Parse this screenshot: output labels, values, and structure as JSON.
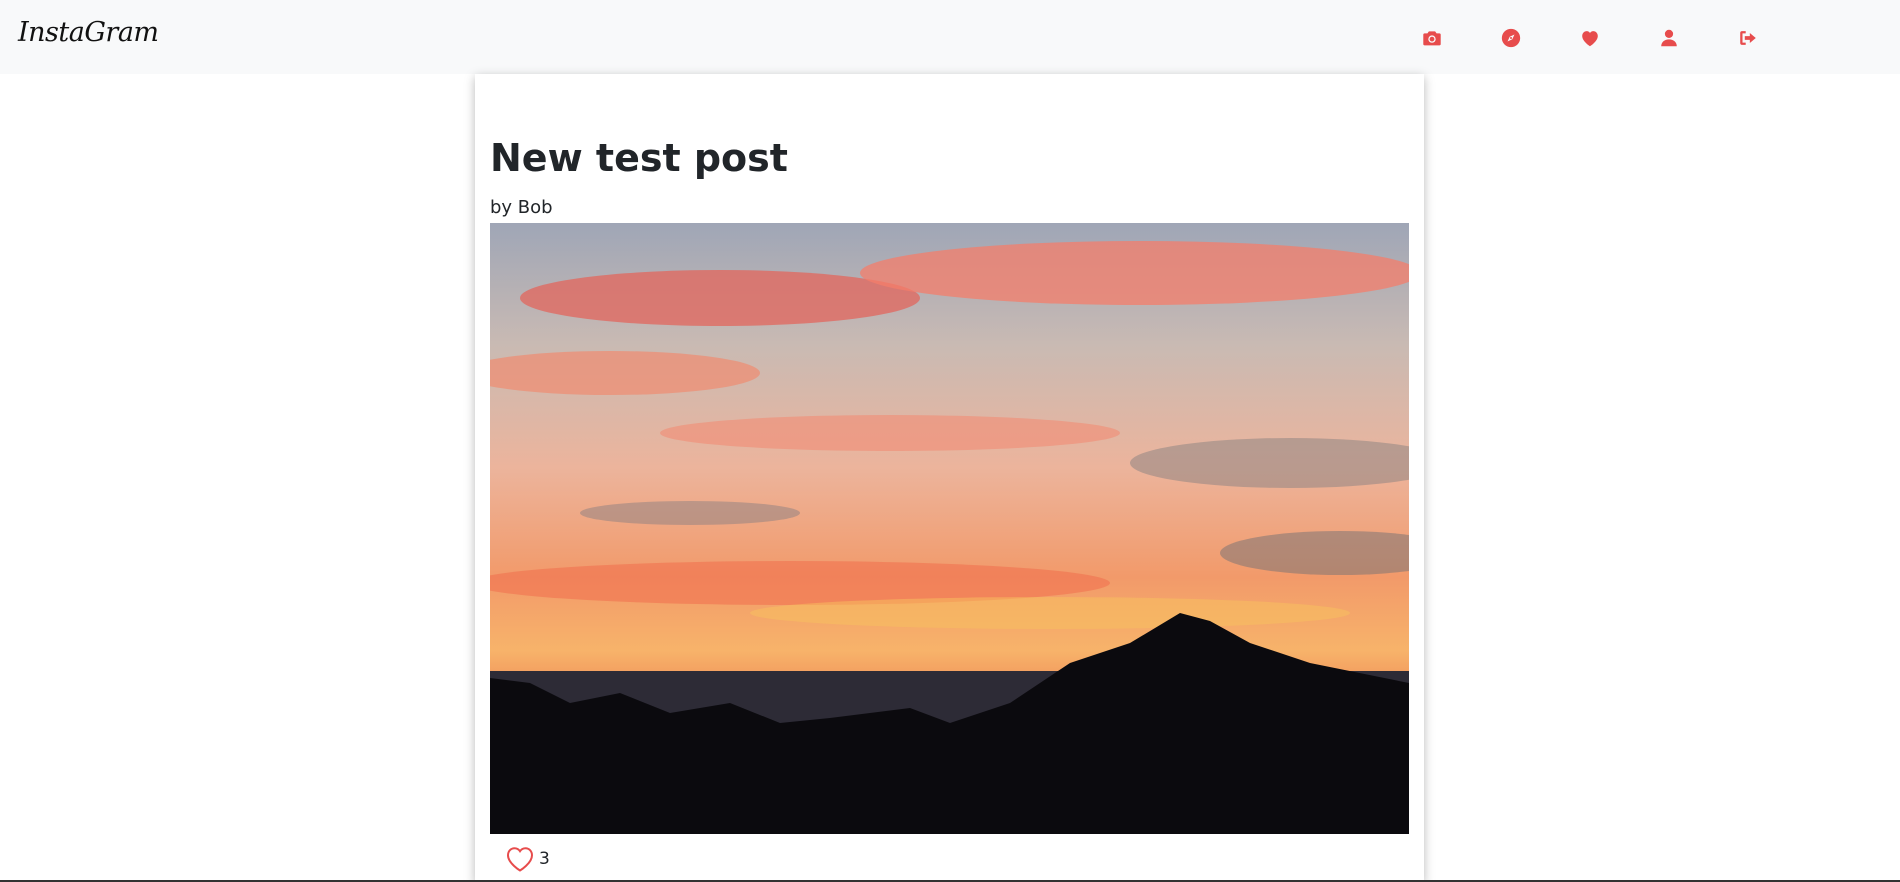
{
  "navbar": {
    "brand": "InstaGram",
    "icons": [
      {
        "name": "camera-icon",
        "color": "#e74c4c"
      },
      {
        "name": "compass-icon",
        "color": "#e74c4c"
      },
      {
        "name": "heart-icon",
        "color": "#e74c4c"
      },
      {
        "name": "user-icon",
        "color": "#e74c4c"
      },
      {
        "name": "sign-out-icon",
        "color": "#e74c4c"
      }
    ]
  },
  "post": {
    "title": "New test post",
    "author": "by Bob",
    "image": "sunset-mountain-photo",
    "likes": "3"
  },
  "colors": {
    "accent": "#e74c4c",
    "navbar_bg": "#f8f9fa"
  }
}
